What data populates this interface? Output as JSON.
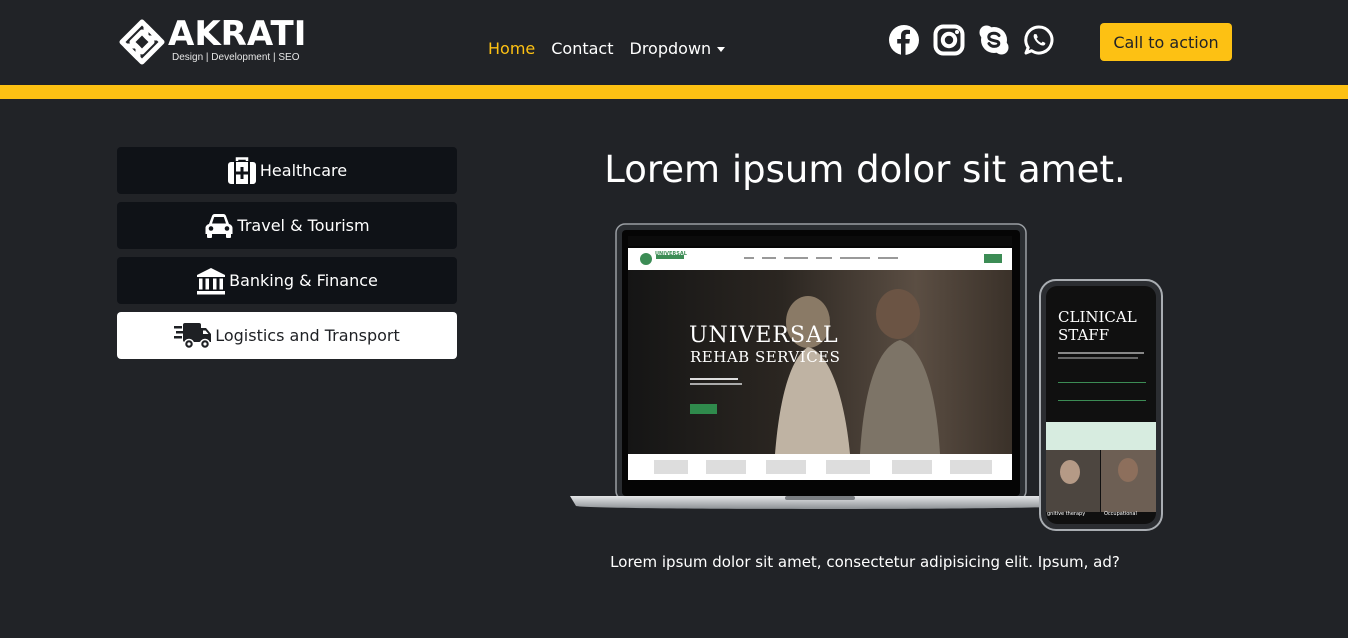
{
  "brand": {
    "name": "AKRATI",
    "tagline": "Design | Development | SEO"
  },
  "nav": {
    "links": [
      {
        "label": "Home",
        "active": true
      },
      {
        "label": "Contact",
        "active": false
      },
      {
        "label": "Dropdown",
        "active": false
      }
    ]
  },
  "social": [
    "facebook-icon",
    "instagram-icon",
    "skype-icon",
    "whatsapp-icon"
  ],
  "cta": {
    "label": "Call to action"
  },
  "colors": {
    "accent": "#fdc113",
    "background": "#212327",
    "menu": "#0f1217"
  },
  "side_menu": {
    "items": [
      {
        "label": "Healthcare",
        "icon": "medkit-icon",
        "selected": false
      },
      {
        "label": "Travel & Tourism",
        "icon": "car-icon",
        "selected": false
      },
      {
        "label": "Banking & Finance",
        "icon": "bank-icon",
        "selected": false
      },
      {
        "label": "Logistics and Transport",
        "icon": "truck-icon",
        "selected": true
      }
    ]
  },
  "main": {
    "title": "Lorem ipsum dolor sit amet.",
    "caption": "Lorem ipsum dolor sit amet, consectetur adipisicing elit. Ipsum, ad?"
  },
  "mockup": {
    "laptop_heading_1": "UNIVERSAL",
    "laptop_heading_2": "REHAB SERVICES",
    "laptop_brand": "UNIVERSAL",
    "phone_heading_1": "CLINICAL",
    "phone_heading_2": "STAFF",
    "phone_label_1": "gnitive therapy",
    "phone_label_2": "Occupational"
  }
}
